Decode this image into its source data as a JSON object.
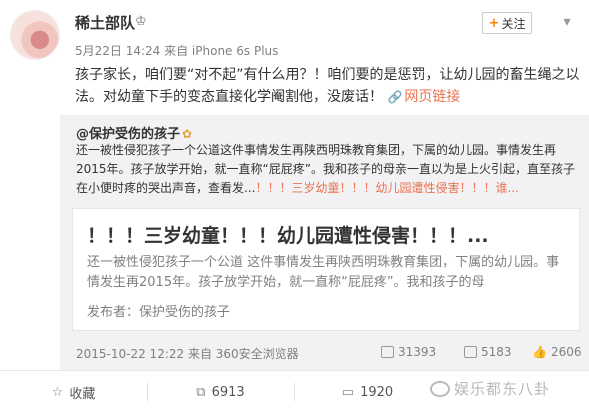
{
  "post": {
    "author": "稀土部队",
    "meta": "5月22日 14:24 来自 iPhone 6s Plus",
    "follow_label": "关注",
    "more_glyph": "▾",
    "content": "孩子家长，咱们要“对不起”有什么用？！咱们要的是惩罚，让幼儿园的畜生绳之以法。对幼童下手的变态直接化学阉割他，没废话！",
    "link_label": "网页链接"
  },
  "repost": {
    "author": "@保护受伤的孩子",
    "text": "还一被性侵犯孩子一个公道这件事情发生再陕西明珠教育集团，下属的幼儿园。事情发生再2015年。孩子放学开始，就一直称“屁屁疼”。我和孩子的母亲一直以为是上火引起，直至孩子在小便时疼的哭出声音，查看发...",
    "link": "！！！三岁幼童！！！幼儿园遭性侵害！！！谁...",
    "card": {
      "title": "！！！三岁幼童！！！幼儿园遭性侵害！！！...",
      "desc": "还一被性侵犯孩子一个公道 这件事情发生再陕西明珠教育集团，下属的幼儿园。事情发生再2015年。孩子放学开始，就一直称“屁屁疼”。我和孩子的母",
      "publisher": "发布者：保护受伤的孩子"
    },
    "time_source": "2015-10-22 12:22 来自 360安全浏览器",
    "reposts": "31393",
    "comments": "5183",
    "likes": "2606"
  },
  "footer": {
    "favorite_label": "收藏",
    "repost_count": "6913",
    "comment_count": "1920"
  },
  "watermark": "娱乐都东八卦"
}
